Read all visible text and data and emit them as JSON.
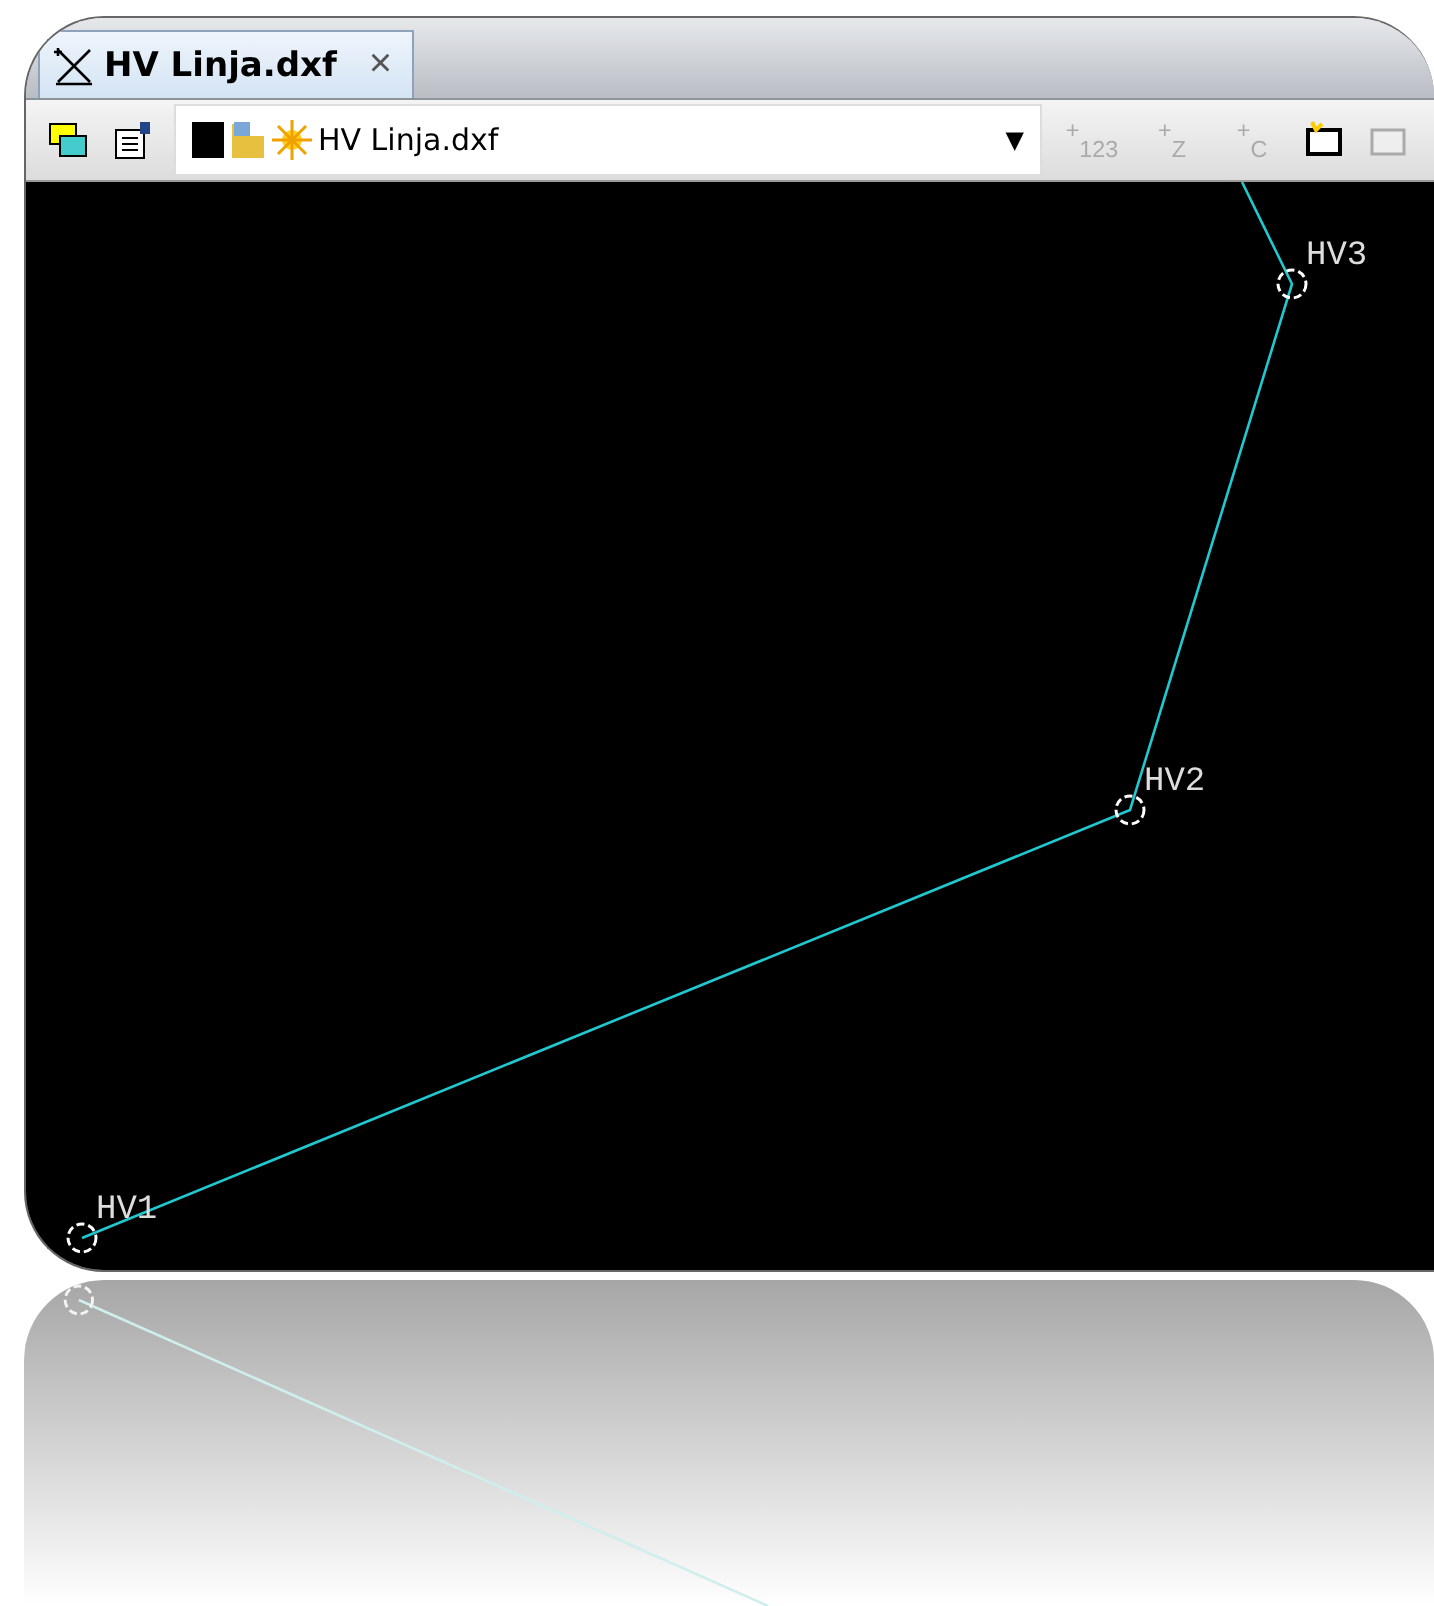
{
  "tabs": [
    {
      "label": "HV Linja.dxf",
      "close": "×",
      "selected": true
    }
  ],
  "toolbar": {
    "combo": {
      "value": "HV Linja.dxf",
      "arrow": "▼"
    },
    "buttons": [
      {
        "label": "$^{+}$$_{123}$",
        "disabled": true
      },
      {
        "label": "$^{+}$$_{Z}$",
        "disabled": true
      },
      {
        "label": "$^{+}$$_{C}$",
        "disabled": true
      }
    ]
  },
  "drawing": {
    "points": [
      {
        "label": "HV1"
      },
      {
        "label": "HV2"
      },
      {
        "label": "HV3"
      }
    ]
  }
}
